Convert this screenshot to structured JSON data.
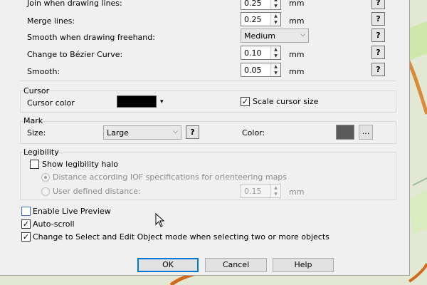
{
  "drawing": {
    "rows": [
      {
        "label": "Join when drawing lines:",
        "value": "0.25",
        "unit": "mm"
      },
      {
        "label": "Merge lines:",
        "value": "0.25",
        "unit": "mm"
      },
      {
        "label": "Change to Bézier Curve:",
        "value": "0.10",
        "unit": "mm"
      },
      {
        "label": "Smooth:",
        "value": "0.05",
        "unit": "mm"
      }
    ],
    "freehand_label": "Smooth when drawing freehand:",
    "freehand_value": "Medium",
    "help_label": "?"
  },
  "cursor": {
    "title": "Cursor",
    "color_label": "Cursor color",
    "color_value": "#000000",
    "scale_label": "Scale cursor size",
    "scale_checked": true
  },
  "mark": {
    "title": "Mark",
    "size_label": "Size:",
    "size_value": "Large",
    "color_label": "Color:",
    "color_value": "#5a5a5a",
    "more_label": "..."
  },
  "legibility": {
    "title": "Legibility",
    "halo_label": "Show legibility halo",
    "iof_label": "Distance according IOF specifications for orienteering maps",
    "user_label": "User defined distance:",
    "user_value": "0.15",
    "user_unit": "mm"
  },
  "options": {
    "live_preview": "Enable Live Preview",
    "auto_scroll": "Auto-scroll",
    "select_mode": "Change to Select and Edit Object mode when selecting two or more objects"
  },
  "buttons": {
    "ok": "OK",
    "cancel": "Cancel",
    "help": "Help"
  },
  "glyphs": {
    "up": "▲",
    "down": "▼",
    "caret": "⌵",
    "small_caret": "▾",
    "check": "✓"
  }
}
